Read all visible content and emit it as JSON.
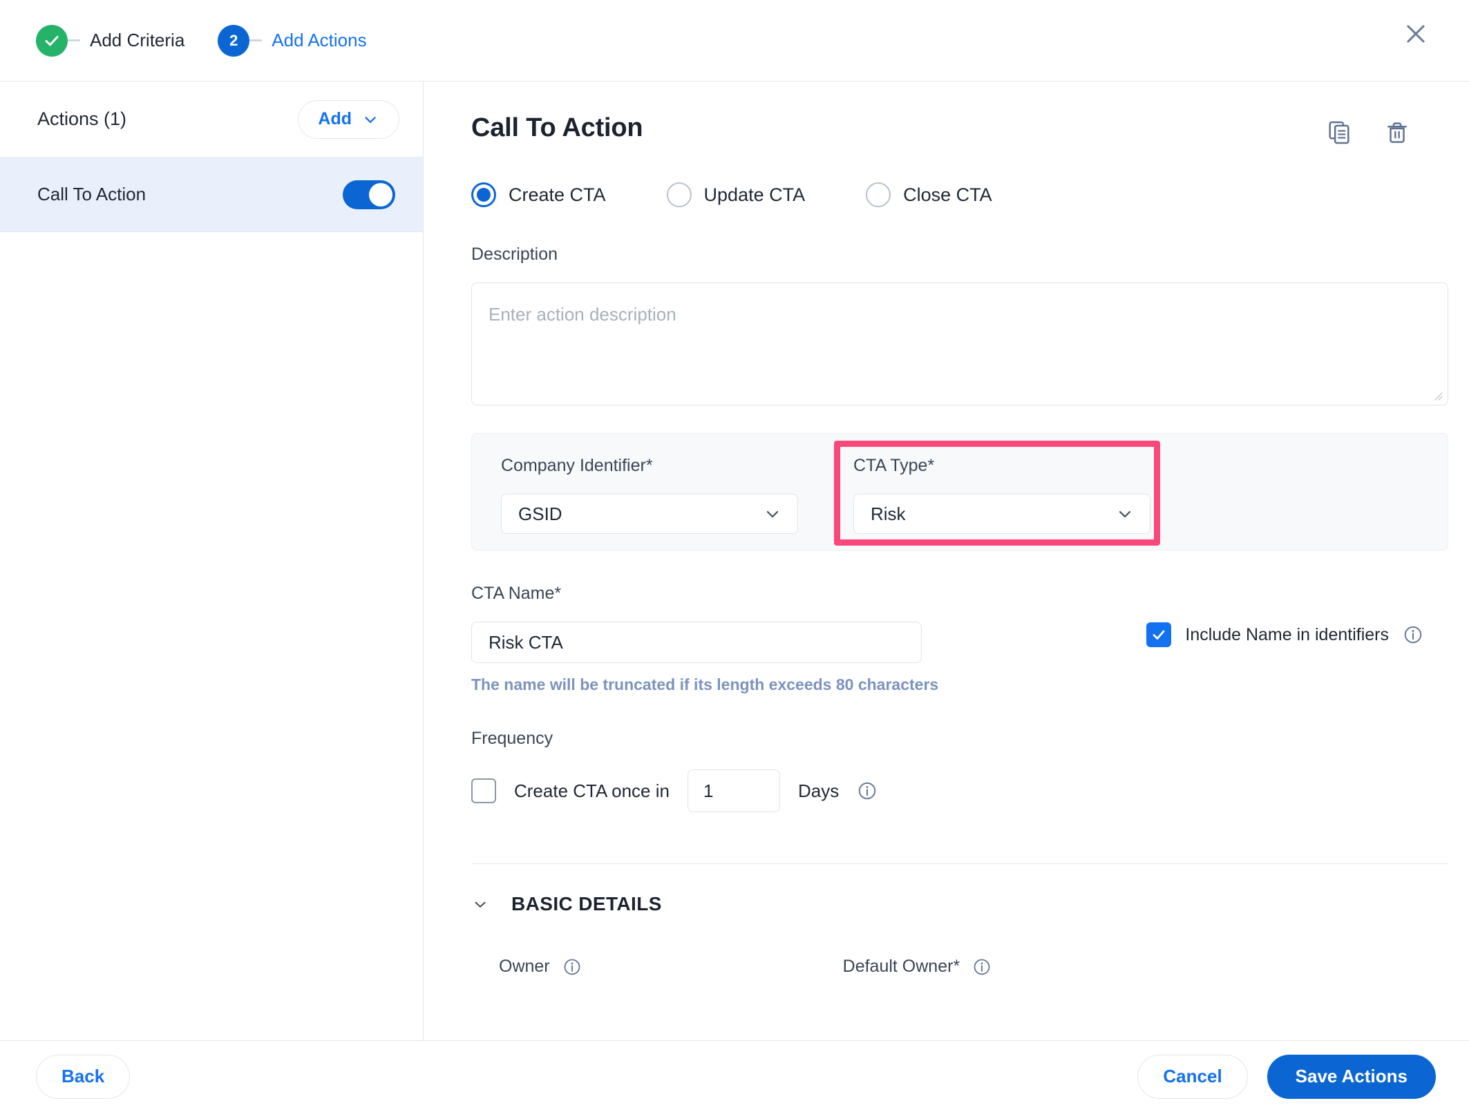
{
  "stepper": {
    "steps": [
      {
        "label": "Add Criteria",
        "state": "done",
        "badge": "check-icon"
      },
      {
        "label": "Add Actions",
        "state": "active",
        "badge": "2"
      }
    ],
    "close_icon": "close-icon"
  },
  "sidebar": {
    "title": "Actions (1)",
    "add_label": "Add",
    "items": [
      {
        "label": "Call To Action",
        "enabled": true
      }
    ]
  },
  "main": {
    "title": "Call To Action",
    "tools": [
      {
        "name": "copy-icon"
      },
      {
        "name": "delete-icon"
      }
    ],
    "mode_options": [
      {
        "label": "Create CTA",
        "selected": true
      },
      {
        "label": "Update CTA",
        "selected": false
      },
      {
        "label": "Close CTA",
        "selected": false
      }
    ],
    "description": {
      "label": "Description",
      "placeholder": "Enter action description",
      "value": ""
    },
    "company_identifier": {
      "label": "Company Identifier",
      "required_mark": "*",
      "value": "GSID"
    },
    "cta_type": {
      "label": "CTA Type",
      "required_mark": "*",
      "value": "Risk",
      "highlight_color": "#f9497b"
    },
    "cta_name": {
      "label": "CTA Name",
      "required_mark": "*",
      "value": "Risk CTA",
      "helper": "The name will be truncated if its length exceeds 80 characters",
      "include_name_label": "Include Name in identifiers",
      "include_name_checked": true
    },
    "frequency": {
      "label": "Frequency",
      "checkbox_label": "Create CTA once in",
      "checked": false,
      "value": "1",
      "unit": "Days"
    },
    "basic_details": {
      "title": "BASIC DETAILS",
      "expanded": true,
      "owner_label": "Owner",
      "default_owner_label": "Default Owner",
      "default_owner_required_mark": "*"
    }
  },
  "footer": {
    "back_label": "Back",
    "cancel_label": "Cancel",
    "save_label": "Save Actions"
  },
  "colors": {
    "accent_blue": "#0b66d3",
    "link_blue": "#1471f0",
    "success_green": "#24b368",
    "highlight_pink": "#f9497b"
  }
}
